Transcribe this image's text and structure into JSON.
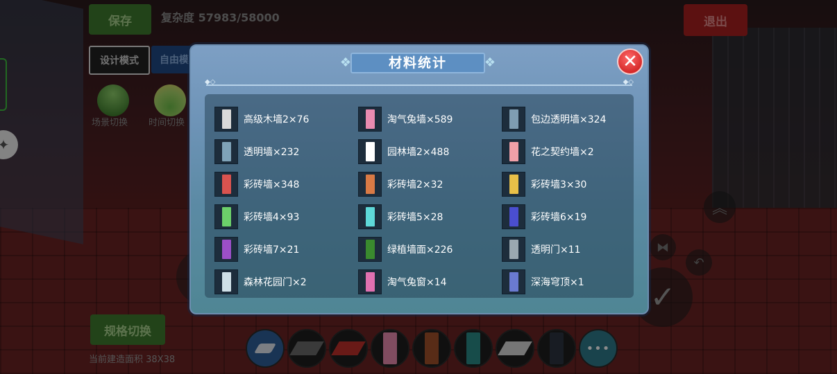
{
  "hud": {
    "save_label": "保存",
    "complexity": "复杂度 57983/58000",
    "exit_label": "退出",
    "design_mode_label": "设计模式",
    "free_mode_label": "自由模",
    "scene_switch_label": "场景切换",
    "time_switch_label": "时间切换",
    "spec_switch_label": "规格切换",
    "build_area_label": "当前建造面积 38X38"
  },
  "modal": {
    "title": "材料统计",
    "close_symbol": "✕",
    "items": [
      {
        "label": "高级木墙2×76",
        "color": "#d9d9d9",
        "icon": "wood-wall-icon"
      },
      {
        "label": "淘气兔墙×589",
        "color": "#e98bb0",
        "icon": "rabbit-wall-icon"
      },
      {
        "label": "包边透明墙×324",
        "color": "#7f9db2",
        "icon": "glass-wall-icon"
      },
      {
        "label": "透明墙×232",
        "color": "#7fa3b8",
        "icon": "glass-wall-icon"
      },
      {
        "label": "园林墙2×488",
        "color": "#ffffff",
        "icon": "garden-wall-icon"
      },
      {
        "label": "花之契约墙×2",
        "color": "#f0a0a8",
        "icon": "flower-wall-icon"
      },
      {
        "label": "彩砖墙×348",
        "color": "#d9534f",
        "icon": "brick-wall-icon"
      },
      {
        "label": "彩砖墙2×32",
        "color": "#d97a45",
        "icon": "brick-wall-icon"
      },
      {
        "label": "彩砖墙3×30",
        "color": "#e8c048",
        "icon": "brick-wall-icon"
      },
      {
        "label": "彩砖墙4×93",
        "color": "#6cd06a",
        "icon": "brick-wall-icon"
      },
      {
        "label": "彩砖墙5×28",
        "color": "#5ed8d8",
        "icon": "brick-wall-icon"
      },
      {
        "label": "彩砖墙6×19",
        "color": "#4a4ed0",
        "icon": "brick-wall-icon"
      },
      {
        "label": "彩砖墙7×21",
        "color": "#9c4fc8",
        "icon": "brick-wall-icon"
      },
      {
        "label": "绿植墙面×226",
        "color": "#3a8a2e",
        "icon": "plant-wall-icon"
      },
      {
        "label": "透明门×11",
        "color": "#9aa8b0",
        "icon": "glass-door-icon"
      },
      {
        "label": "森林花园门×2",
        "color": "#cfe0e8",
        "icon": "forest-gate-icon"
      },
      {
        "label": "淘气兔窗×14",
        "color": "#e070b0",
        "icon": "rabbit-window-icon"
      },
      {
        "label": "深海穹顶×1",
        "color": "#6a7ad0",
        "icon": "dome-icon"
      }
    ]
  },
  "hotbar": {
    "slots": [
      {
        "icon": "eraser-icon",
        "color": "#e0e6ee"
      },
      {
        "icon": "floor-tile-icon",
        "color": "#6a6a6a"
      },
      {
        "icon": "floor-tile-icon",
        "color": "#c0302a"
      },
      {
        "icon": "rabbit-wall-icon",
        "color": "#e98bb0"
      },
      {
        "icon": "brick-wall-icon",
        "color": "#a0502a"
      },
      {
        "icon": "glass-wall-icon",
        "color": "#2a8a88"
      },
      {
        "icon": "floor-tile-icon",
        "color": "#d8d8d8"
      },
      {
        "icon": "dark-wall-icon",
        "color": "#2c3440"
      }
    ],
    "more_label": "•••"
  }
}
